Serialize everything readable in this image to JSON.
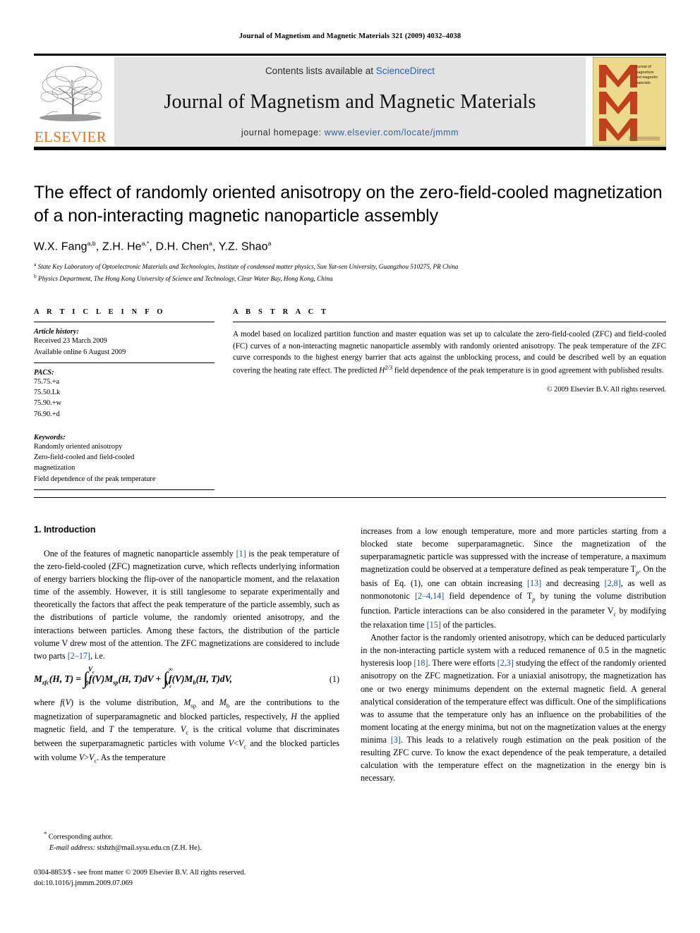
{
  "running_head": "Journal of Magnetism and Magnetic Materials 321 (2009) 4032–4038",
  "masthead": {
    "publisher_name": "ELSEVIER",
    "contents_prefix": "Contents lists available at ",
    "sciencedirect": "ScienceDirect",
    "journal_title": "Journal of Magnetism and Magnetic Materials",
    "homepage_prefix": "journal homepage: ",
    "homepage_url": "www.elsevier.com/locate/jmmm",
    "cover_caption": "journal of magnetism and magnetic materials",
    "cover_bg": "#ecd98b",
    "cover_m_color": "#c0401e",
    "sciencedirect_color": "#2e5fa3",
    "elsevier_orange": "#E9711C"
  },
  "article": {
    "title": "The effect of randomly oriented anisotropy on the zero-field-cooled magnetization of a non-interacting magnetic nanoparticle assembly",
    "authors_html": "W.X. Fang <sup>a,b</sup>, Z.H. He <sup>a,</sup>*, D.H. Chen <sup>a</sup>, Y.Z. Shao <sup>a</sup>",
    "affiliation_a": "State Key Laboratory of Optoelectronic Materials and Technologies, Institute of condensed matter physics, Sun Yat-sen University, Guangzhou 510275, PR China",
    "affiliation_b": "Physics Department, The Hong Kong University of Science and Technology, Clear Water Bay, Hong Kong, China"
  },
  "info": {
    "heading": "A R T I C L E   I N F O",
    "history_label": "Article history:",
    "history": [
      "Received 23 March 2009",
      "Available online 6 August 2009"
    ],
    "pacs_label": "PACS:",
    "pacs": [
      "75.75.+a",
      "75.50.Lk",
      "75.90.+w",
      "76.90.+d"
    ],
    "keywords_label": "Keywords:",
    "keywords": [
      "Randomly oriented anisotropy",
      "Zero-field-cooled and field-cooled",
      "magnetization",
      "Field dependence of the peak temperature"
    ]
  },
  "abstract": {
    "heading": "A B S T R A C T",
    "text_before_sup": "A model based on localized partition function and master equation was set up to calculate the zero-field-cooled (ZFC) and field-cooled (FC) curves of a non-interacting magnetic nanoparticle assembly with randomly oriented anisotropy. The peak temperature of the ZFC curve corresponds to the highest energy barrier that acts against the unblocking process, and could be described well by an equation covering the heating rate effect. The predicted ",
    "sup_symbol": "H",
    "sup_exponent": "2/3",
    "text_after_sup": " field dependence of the peak temperature is in good agreement with published results.",
    "copyright": "© 2009 Elsevier B.V. All rights reserved."
  },
  "section": {
    "number_title": "1.  Introduction"
  },
  "left_column": {
    "p1_part1": "One of the features of magnetic nanoparticle assembly ",
    "p1_ref1": "[1]",
    "p1_part2": " is the peak temperature of the zero-field-cooled (ZFC) magnetization curve, which reflects underlying information of energy barriers blocking the flip-over of the nanoparticle moment, and the relaxation time of the assembly. However, it is still tanglesome to separate experimentally and theoretically the factors that affect the peak temperature of the particle assembly, such as the distributions of particle volume, the randomly oriented anisotropy, and the interactions between particles. Among these factors, the distribution of the particle volume V drew most of the attention. The ZFC magnetizations are considered to include two parts ",
    "p1_ref2": "[2–17]",
    "p1_part3": ", i.e.",
    "equation": {
      "lhs": "M",
      "lhs_sub": "zfc",
      "lhs_args": "(H, T) =",
      "int1_upper": "V",
      "int1_upper_sub": "c",
      "int1_lower": "0",
      "int1_body": "f(V)M",
      "int1_body_sub": "sp",
      "int1_body_tail": "(H, T)dV +",
      "int2_upper": "∞",
      "int2_lower": "V",
      "int2_lower_sub": "c",
      "int2_body": "f(V)M",
      "int2_body_sub": "b",
      "int2_body_tail": "(H, T)dV,",
      "number": "(1)"
    },
    "p2": "where f(V) is the volume distribution, Msp and Mb are the contributions to the magnetization of superparamagnetic and blocked particles, respectively, H the applied magnetic field, and T the temperature. Vc is the critical volume that discriminates between the superparamagnetic particles with volume V<Vc and the blocked particles with volume V>Vc. As the temperature"
  },
  "right_column": {
    "p1_a": "increases from a low enough temperature, more and more particles starting from a blocked state become superparamagnetic. Since the magnetization of the superparamagnetic particle was suppressed with the increase of temperature, a maximum magnetization could be observed at a temperature defined as peak temperature T",
    "p1_sub1": "p",
    "p1_b": ". On the basis of Eq. (1), one can obtain increasing ",
    "p1_ref1": "[13]",
    "p1_c": " and decreasing ",
    "p1_ref2": "[2,8]",
    "p1_d": ", as well as nonmonotonic ",
    "p1_ref3": "[2–4,14]",
    "p1_e": " field dependence of T",
    "p1_sub2": "p",
    "p1_f": " by tuning the volume distribution function. Particle interactions can be also considered in the parameter V",
    "p1_sub3": "c",
    "p1_g": " by modifying the relaxation time ",
    "p1_ref4": "[15]",
    "p1_h": " of the particles.",
    "p2_a": "Another factor is the randomly oriented anisotropy, which can be deduced particularly in the non-interacting particle system with a reduced remanence of 0.5 in the magnetic hysteresis loop ",
    "p2_ref1": "[18]",
    "p2_b": ". There were efforts ",
    "p2_ref2": "[2,3]",
    "p2_c": " studying the effect of the randomly oriented anisotropy on the ZFC magnetization. For a uniaxial anisotropy, the magnetization has one or two energy minimums dependent on the external magnetic field. A general analytical consideration of the temperature effect was difficult. One of the simplifications was to assume that the temperature only has an influence on the probabilities of the moment locating at the energy minima, but not on the magnetization values at the energy minima ",
    "p2_ref3": "[3]",
    "p2_d": ". This leads to a relatively rough estimation on the peak position of the resulting ZFC curve. To know the exact dependence of the peak temperature, a detailed calculation with the temperature effect on the magnetization in the energy bin is necessary."
  },
  "footnote": {
    "corresponding": "Corresponding author.",
    "email_label": "E-mail address:",
    "email": " stshzh@mail.sysu.edu.cn (Z.H. He).",
    "imprint_line1": "0304-8853/$ - see front matter © 2009 Elsevier B.V. All rights reserved.",
    "imprint_line2": "doi:10.1016/j.jmmm.2009.07.069"
  }
}
